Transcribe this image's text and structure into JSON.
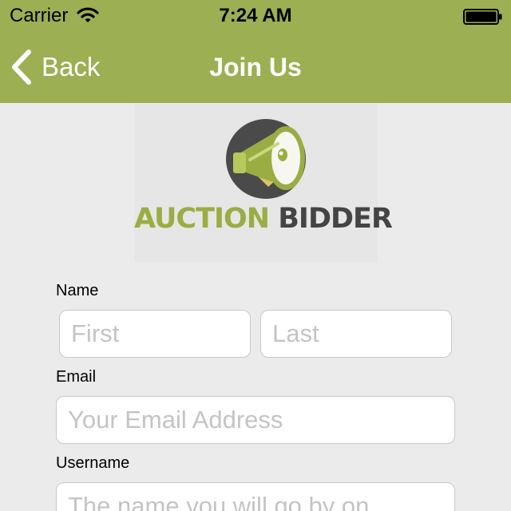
{
  "status_bar": {
    "carrier": "Carrier",
    "time": "7:24 AM",
    "wifi_icon": "wifi-icon",
    "battery_icon": "battery-full-icon"
  },
  "nav": {
    "back_label": "Back",
    "title": "Join Us"
  },
  "logo": {
    "word_1": "AUCTION",
    "word_2": "BIDDER",
    "icon": "megaphone-icon"
  },
  "form": {
    "name_label": "Name",
    "first_placeholder": "First",
    "last_placeholder": "Last",
    "email_label": "Email",
    "email_placeholder": "Your Email Address",
    "username_label": "Username",
    "username_placeholder": "The name you will go by on"
  },
  "colors": {
    "header_green": "#9caf52",
    "logo_green": "#9aad43",
    "logo_gray": "#444444",
    "background": "#ebebeb"
  }
}
